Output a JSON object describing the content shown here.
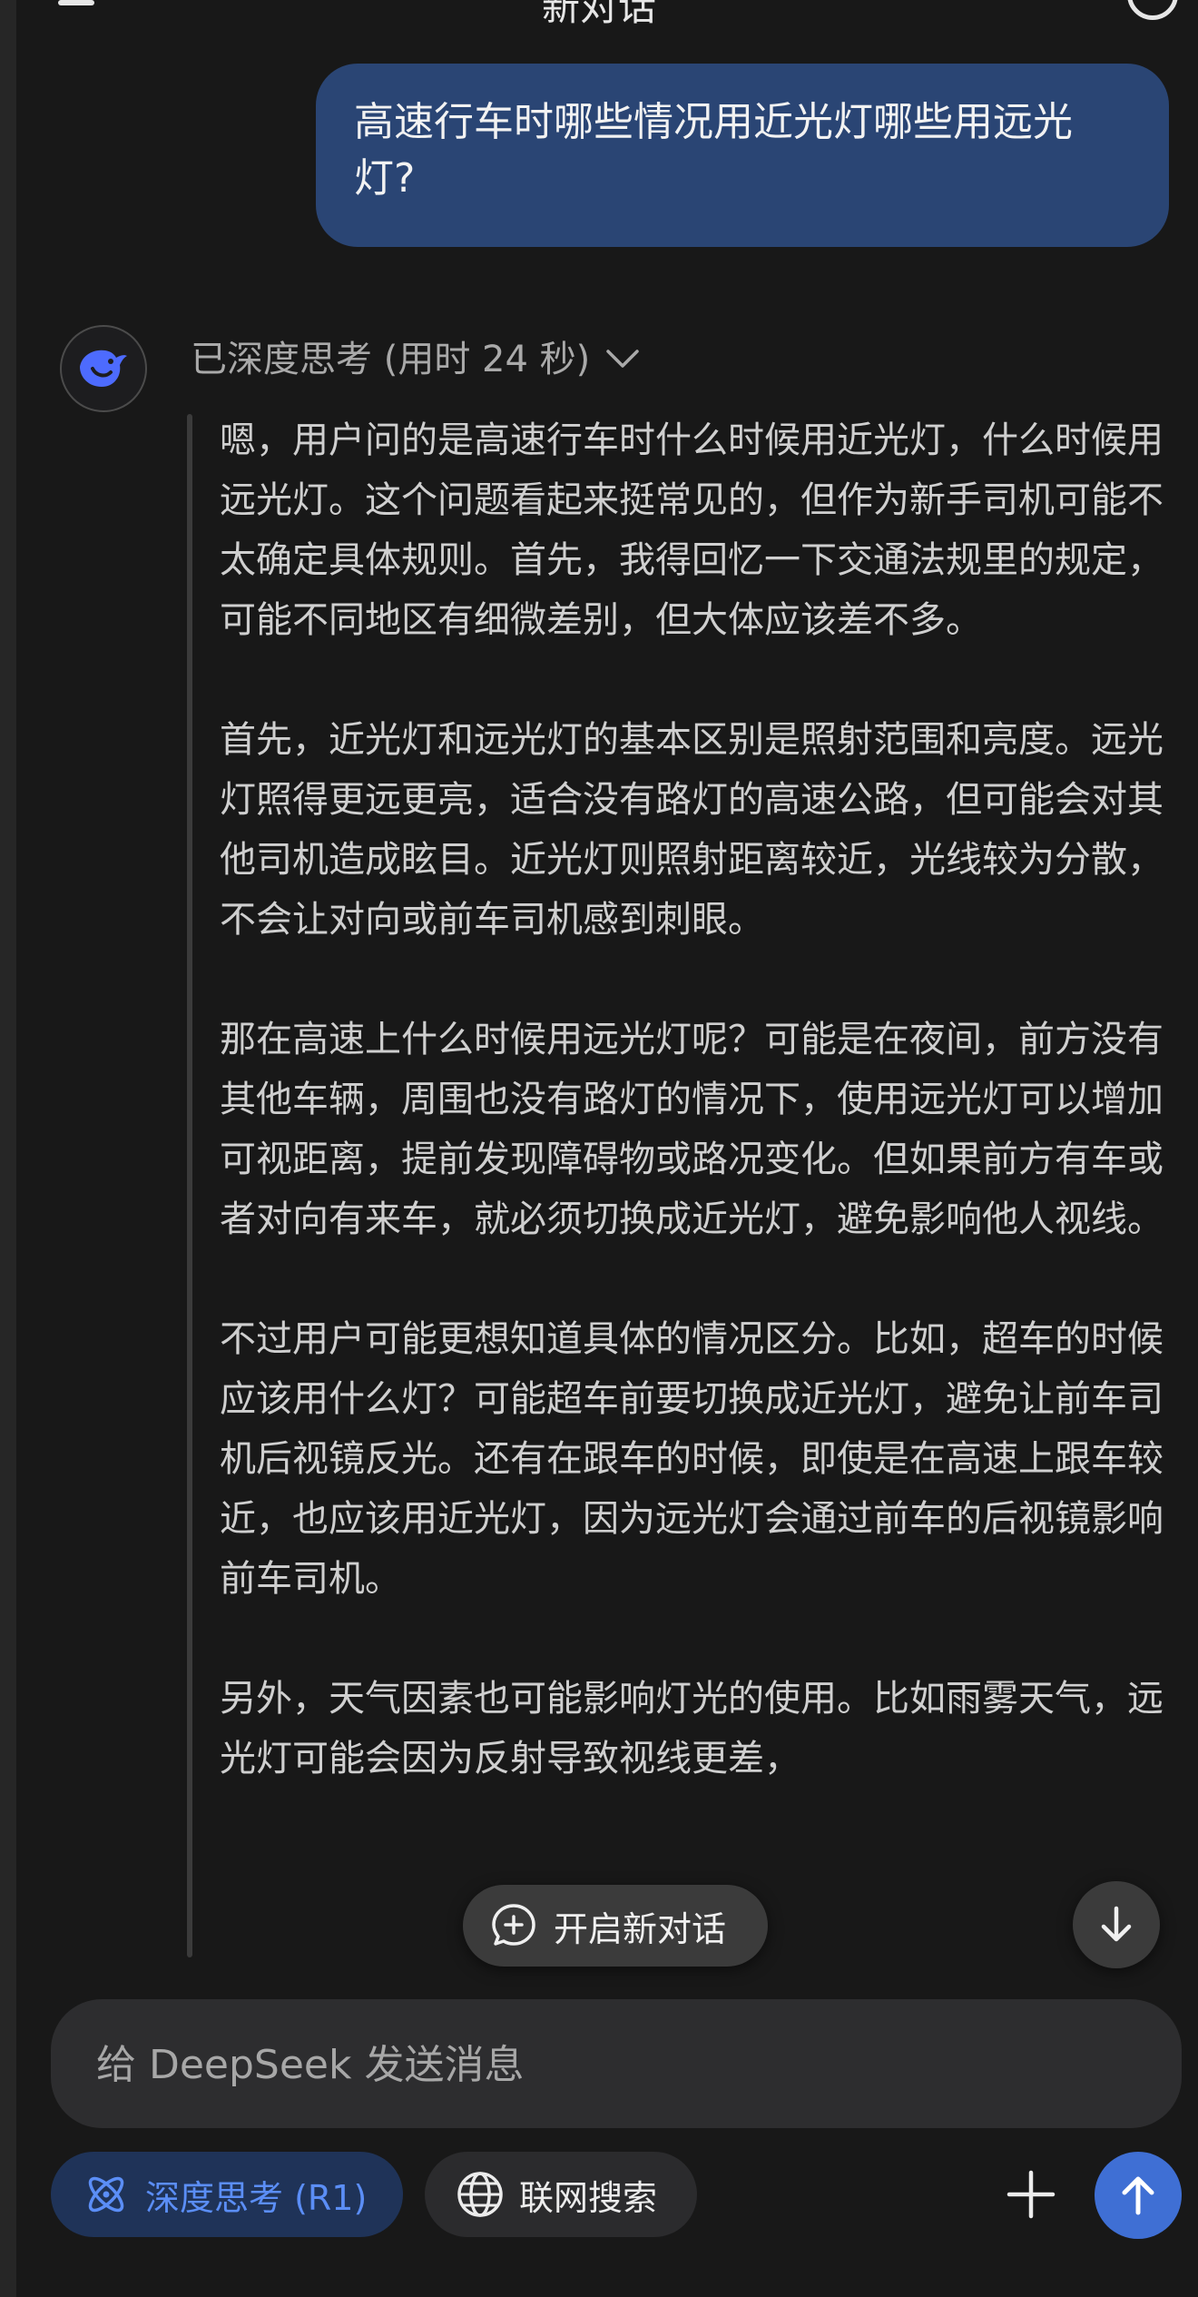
{
  "header": {
    "title": "新对话"
  },
  "user_message": "高速行车时哪些情况用近光灯哪些用远光灯?",
  "assistant": {
    "avatar_icon": "deepseek-whale-icon",
    "thinking_label": "已深度思考 (用时 24 秒)",
    "reasoning": [
      "嗯，用户问的是高速行车时什么时候用近光灯，什么时候用远光灯。这个问题看起来挺常见的，但作为新手司机可能不太确定具体规则。首先，我得回忆一下交通法规里的规定，可能不同地区有细微差别，但大体应该差不多。",
      "首先，近光灯和远光灯的基本区别是照射范围和亮度。远光灯照得更远更亮，适合没有路灯的高速公路，但可能会对其他司机造成眩目。近光灯则照射距离较近，光线较为分散，不会让对向或前车司机感到刺眼。",
      "那在高速上什么时候用远光灯呢？可能是在夜间，前方没有其他车辆，周围也没有路灯的情况下，使用远光灯可以增加可视距离，提前发现障碍物或路况变化。但如果前方有车或者对向有来车，就必须切换成近光灯，避免影响他人视线。",
      "不过用户可能更想知道具体的情况区分。比如，超车的时候应该用什么灯？可能超车前要切换成近光灯，避免让前车司机后视镜反光。还有在跟车的时候，即使是在高速上跟车较近，也应该用近光灯，因为远光灯会通过前车的后视镜影响前车司机。",
      "另外，天气因素也可能影响灯光的使用。比如雨雾天气，远光灯可能会因为反射导致视线更差，"
    ]
  },
  "overlay": {
    "new_chat_label": "开启新对话"
  },
  "composer": {
    "placeholder": "给 DeepSeek 发送消息",
    "value": ""
  },
  "toolbar": {
    "deep_think_label": "深度思考 (R1)",
    "web_search_label": "联网搜索"
  },
  "colors": {
    "accent": "#3f6fd4",
    "user_bubble": "#2a4574",
    "background": "#181818"
  }
}
